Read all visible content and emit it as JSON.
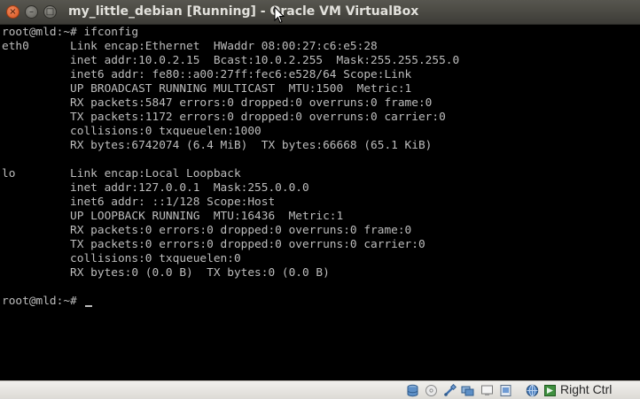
{
  "window": {
    "title": "my_little_debian [Running] - Oracle VM VirtualBox",
    "close_glyph": "×",
    "minimize_glyph": "–",
    "maximize_glyph": "□"
  },
  "terminal": {
    "lines": [
      "root@mld:~# ifconfig",
      "eth0      Link encap:Ethernet  HWaddr 08:00:27:c6:e5:28",
      "          inet addr:10.0.2.15  Bcast:10.0.2.255  Mask:255.255.255.0",
      "          inet6 addr: fe80::a00:27ff:fec6:e528/64 Scope:Link",
      "          UP BROADCAST RUNNING MULTICAST  MTU:1500  Metric:1",
      "          RX packets:5847 errors:0 dropped:0 overruns:0 frame:0",
      "          TX packets:1172 errors:0 dropped:0 overruns:0 carrier:0",
      "          collisions:0 txqueuelen:1000",
      "          RX bytes:6742074 (6.4 MiB)  TX bytes:66668 (65.1 KiB)",
      "",
      "lo        Link encap:Local Loopback",
      "          inet addr:127.0.0.1  Mask:255.0.0.0",
      "          inet6 addr: ::1/128 Scope:Host",
      "          UP LOOPBACK RUNNING  MTU:16436  Metric:1",
      "          RX packets:0 errors:0 dropped:0 overruns:0 frame:0",
      "          TX packets:0 errors:0 dropped:0 overruns:0 carrier:0",
      "          collisions:0 txqueuelen:0",
      "          RX bytes:0 (0.0 B)  TX bytes:0 (0.0 B)",
      "",
      "root@mld:~# "
    ]
  },
  "statusbar": {
    "host_key_label": "Right Ctrl",
    "icons": [
      "hard-disk-icon",
      "optical-drive-icon",
      "usb-icon",
      "shared-folders-icon",
      "display-icon",
      "video-capture-icon",
      "network-icon",
      "mouse-integration-icon"
    ]
  },
  "colors": {
    "terminal_bg": "#000000",
    "terminal_fg": "#bdbdbd",
    "titlebar": "#3d3c37",
    "close_button": "#d9531e"
  }
}
